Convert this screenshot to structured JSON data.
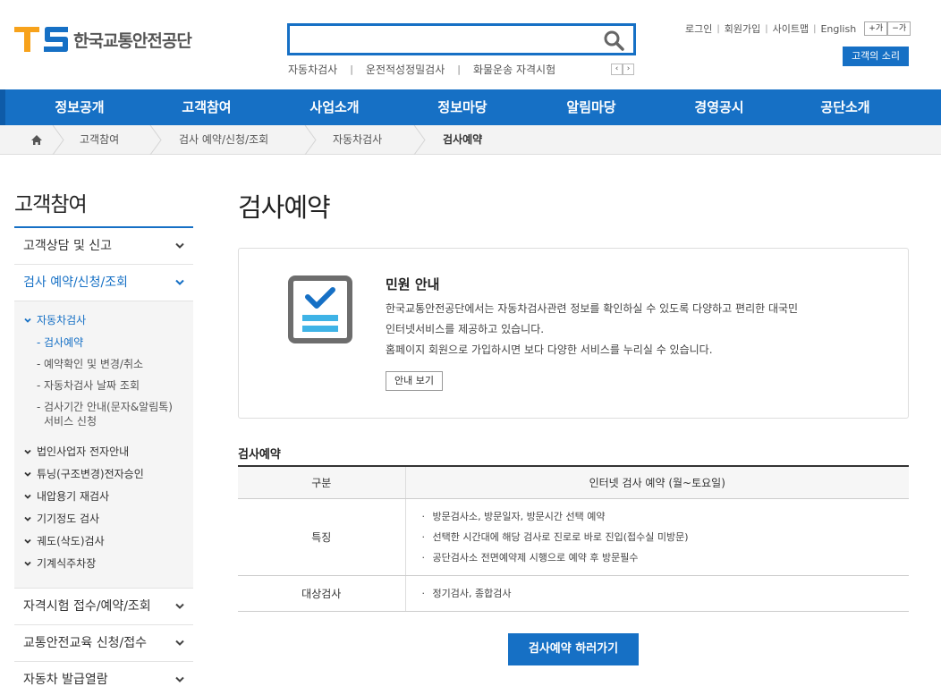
{
  "header": {
    "logo_mark": "TS",
    "logo_text": "한국교통안전공단",
    "search_placeholder": "",
    "quick_links": [
      "자동차검사",
      "운전적성정밀검사",
      "화물운송 자격시험"
    ],
    "quick_prev": "‹",
    "quick_next": "›",
    "util_links": [
      "로그인",
      "회원가입",
      "사이트맵",
      "English"
    ],
    "font_plus": "+가",
    "font_minus": "−가",
    "voice_button": "고객의 소리"
  },
  "gnb": {
    "items": [
      "정보공개",
      "고객참여",
      "사업소개",
      "정보마당",
      "알림마당",
      "경영공시",
      "공단소개"
    ]
  },
  "breadcrumb": {
    "items": [
      "고객참여",
      "검사 예약/신청/조회",
      "자동차검사",
      "검사예약"
    ]
  },
  "sidebar": {
    "title": "고객참여",
    "items": [
      {
        "label": "고객상담 및 신고"
      },
      {
        "label": "검사 예약/신청/조회"
      },
      {
        "label": "자격시험 접수/예약/조회"
      },
      {
        "label": "교통안전교육 신청/접수"
      },
      {
        "label": "자동차 발급열람"
      }
    ],
    "sub": {
      "group": "자동차검사",
      "leaves": [
        "검사예약",
        "예약확인 및 변경/취소",
        "자동차검사 날짜 조회",
        "검사기간 안내(문자&알림톡)",
        "서비스 신청"
      ],
      "others": [
        "법인사업자 전자안내",
        "튜닝(구조변경)전자승인",
        "내압용기 재검사",
        "기기정도 검사",
        "궤도(삭도)검사",
        "기계식주차장"
      ]
    }
  },
  "main": {
    "page_title": "검사예약",
    "info": {
      "title": "민원 안내",
      "lines": [
        "한국교통안전공단에서는 자동차검사관련 정보를 확인하실 수 있도록 다양하고 편리한 대국민",
        "인터넷서비스를 제공하고 있습니다.",
        "홈페이지 회원으로 가입하시면 보다 다양한 서비스를 누리실 수 있습니다."
      ],
      "button": "안내 보기"
    },
    "section_title": "검사예약",
    "table": {
      "headers": [
        "구분",
        "인터넷 검사 예약 (월~토요일)"
      ],
      "rows": [
        {
          "label": "특징",
          "items": [
            "방문검사소, 방문일자, 방문시간 선택 예약",
            "선택한 시간대에 해당 검사로 진로로 바로 진입(접수실 미방문)",
            "공단검사소 전면예약제 시행으로 예약 후 방문필수"
          ]
        },
        {
          "label": "대상검사",
          "items": [
            "정기검사, 종합검사"
          ]
        }
      ]
    },
    "reserve_button": "검사예약 하러가기"
  },
  "colors": {
    "brand_blue": "#1670c5",
    "logo_orange": "#f7a21b",
    "logo_blue": "#1670c5"
  }
}
